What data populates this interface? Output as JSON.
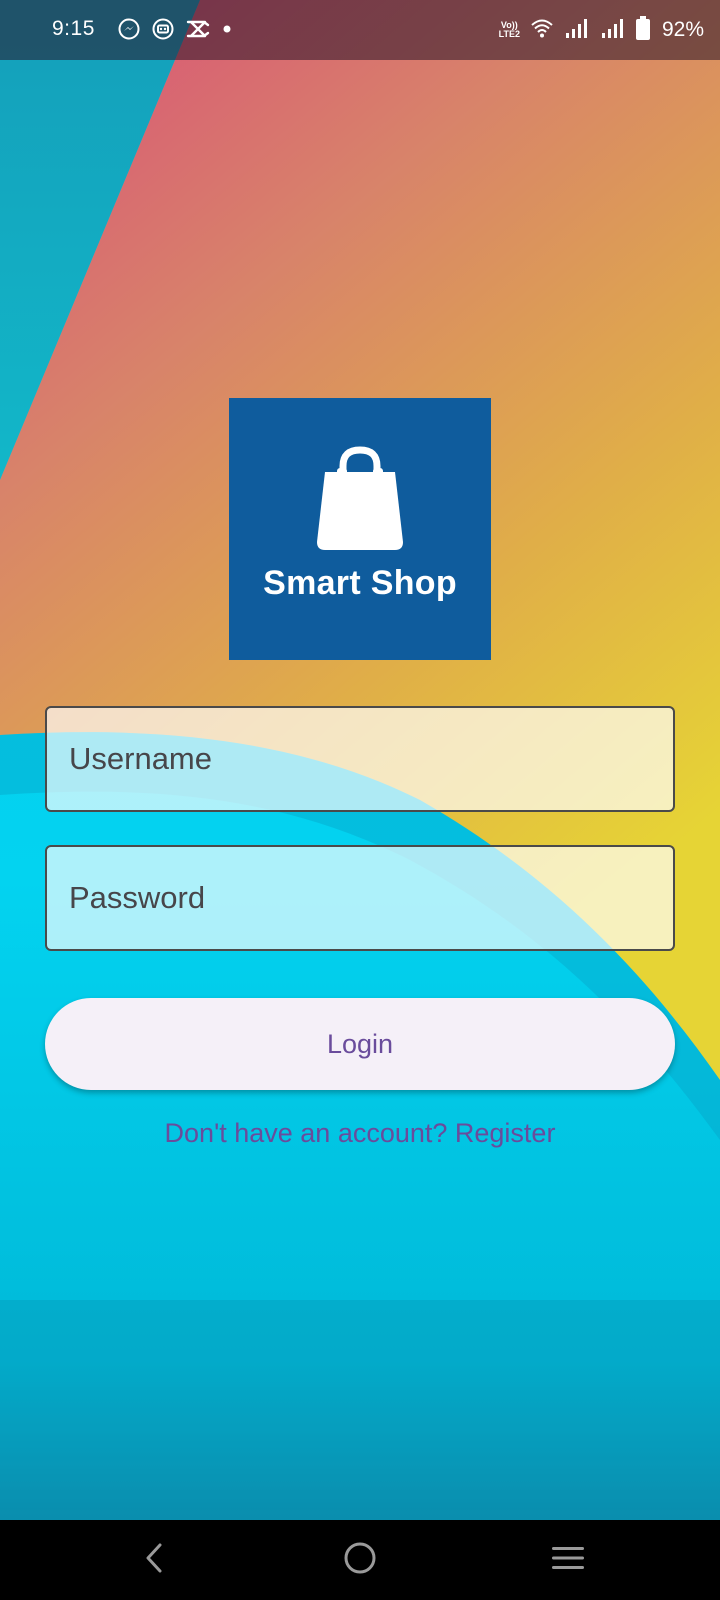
{
  "status_bar": {
    "time": "9:15",
    "battery_percent": "92%",
    "volte_top": "Vo))",
    "volte_bottom": "LTE2",
    "icons_left": [
      "messenger-icon",
      "app-notification-icon",
      "capcut-icon",
      "dot-icon"
    ],
    "icons_right": [
      "volte-icon",
      "wifi-icon",
      "signal-icon",
      "signal-icon",
      "battery-icon"
    ]
  },
  "logo": {
    "text": "Smart Shop",
    "icon": "shopping-bag-icon",
    "background": "#0f5c9d"
  },
  "form": {
    "username_placeholder": "Username",
    "password_placeholder": "Password",
    "login_label": "Login",
    "register_text": "Don't have an account? Register"
  },
  "colors": {
    "accent": "#6a4c9c",
    "button_bg": "#f5f0f8",
    "wallpaper_cyan": "#06c6e6",
    "wallpaper_pink": "#d65d7a",
    "wallpaper_yellow": "#e5c93a"
  },
  "nav_bar": {
    "icons": [
      "back-icon",
      "home-icon",
      "recents-icon"
    ]
  }
}
